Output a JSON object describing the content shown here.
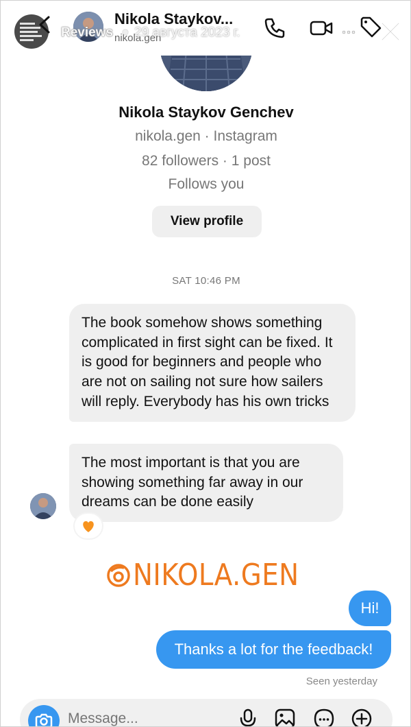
{
  "story_overlay": {
    "label": "Reviews",
    "date": "29 августа 2023 г."
  },
  "header": {
    "name": "Nikola Staykov...",
    "handle": "nikola.gen",
    "icons": [
      "back-chevron-icon",
      "phone-icon",
      "video-camera-icon",
      "more-icon",
      "tag-icon",
      "close-icon"
    ]
  },
  "profile": {
    "full_name": "Nikola Staykov Genchev",
    "handle_line": "nikola.gen · Instagram",
    "stats_line": "82 followers · 1 post",
    "follow_status": "Follows you",
    "view_profile_label": "View profile"
  },
  "thread": {
    "timestamp": "SAT 10:46 PM",
    "incoming": [
      "The book somehow shows something complicated in first sight can be fixed. It is good for beginners and people who are not on sailing not sure how sailers will reply. Everybody has his own tricks",
      "The most important is that you are showing something far away in our dreams can be done easily"
    ],
    "reaction": "🧡",
    "outgoing": [
      "Hi!",
      "Thanks a lot for the feedback!"
    ],
    "seen_status": "Seen yesterday"
  },
  "watermark": {
    "text": "NIKOLA.GEN",
    "color": "#ee7a1f"
  },
  "composer": {
    "placeholder": "Message...",
    "icons": [
      "camera-icon",
      "microphone-icon",
      "gallery-icon",
      "sticker-icon",
      "plus-icon"
    ]
  },
  "colors": {
    "accent": "#3797f0",
    "incoming_bubble": "#efefef",
    "watermark": "#ee7a1f"
  }
}
